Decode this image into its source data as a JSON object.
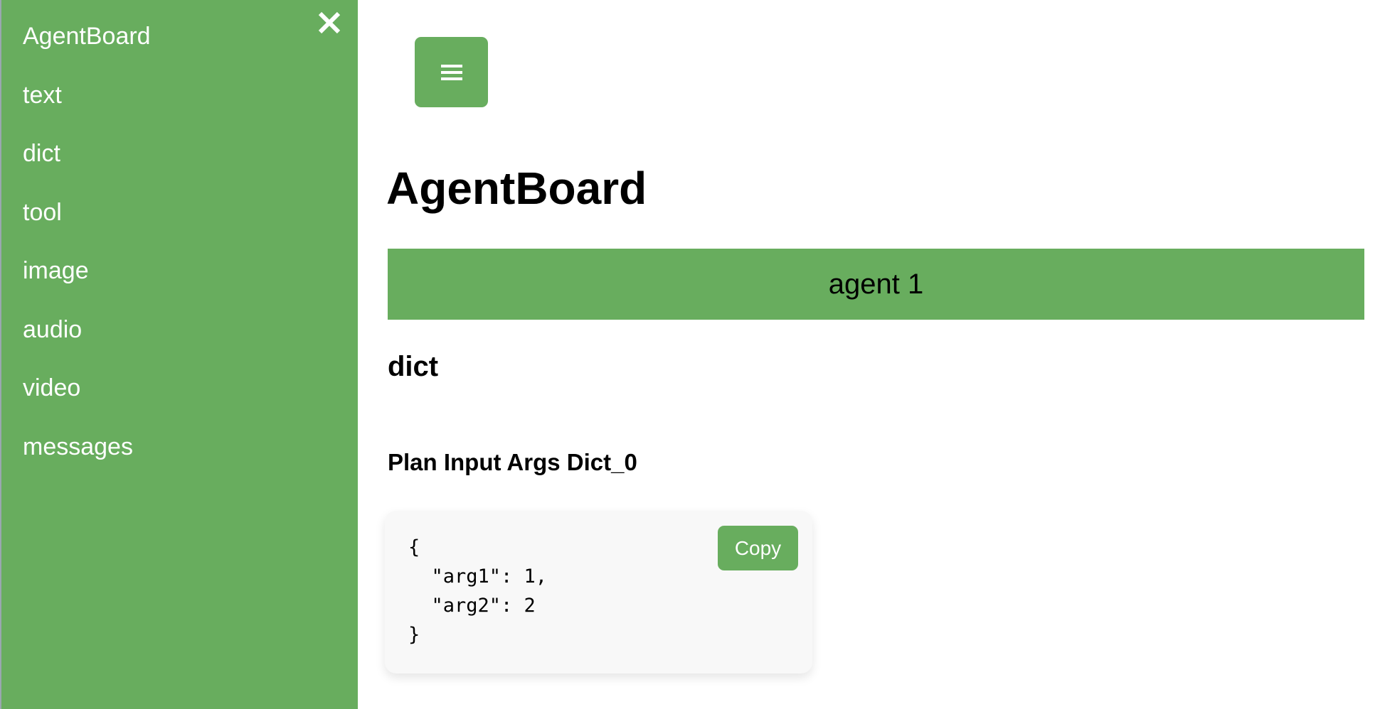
{
  "theme": {
    "accent": "#68ad5e",
    "code_background": "#f8f8f8",
    "text": "#000000",
    "sidebar_text": "#ffffff"
  },
  "sidebar": {
    "close_icon": "close-icon",
    "items": [
      {
        "label": "AgentBoard"
      },
      {
        "label": "text"
      },
      {
        "label": "dict"
      },
      {
        "label": "tool"
      },
      {
        "label": "image"
      },
      {
        "label": "audio"
      },
      {
        "label": "video"
      },
      {
        "label": "messages"
      }
    ]
  },
  "header": {
    "menu_icon": "hamburger-menu-icon",
    "title": "AgentBoard"
  },
  "main": {
    "agent_label": "agent 1",
    "section_title": "dict",
    "item_title": "Plan Input Args Dict_0",
    "code": "{\n  \"arg1\": 1,\n  \"arg2\": 2\n}",
    "copy_label": "Copy"
  }
}
